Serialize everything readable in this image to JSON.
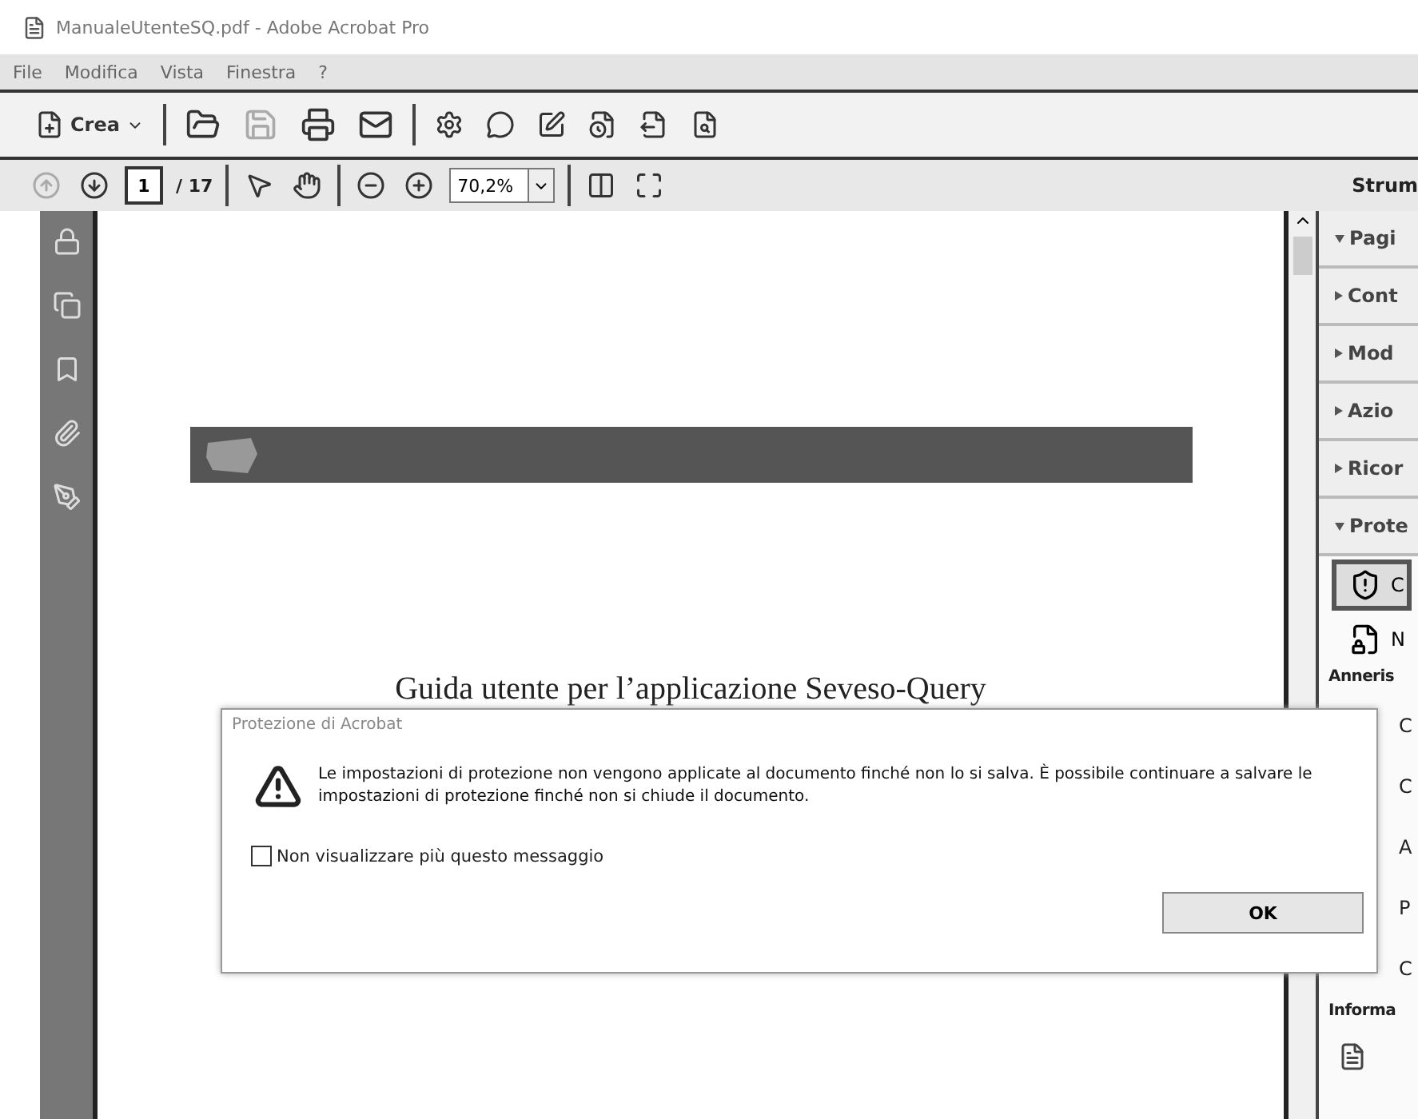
{
  "window": {
    "title": "ManualeUtenteSQ.pdf - Adobe Acrobat Pro"
  },
  "menu": [
    "File",
    "Modifica",
    "Vista",
    "Finestra",
    "?"
  ],
  "toolbar": {
    "create_label": "Crea"
  },
  "navigation": {
    "page": "1",
    "page_count": "/ 17",
    "zoom": "70,2%",
    "tools_label": "Strum"
  },
  "document": {
    "title": "Guida utente per l’applicazione Seveso-Query"
  },
  "right_panel": {
    "sections": [
      {
        "label": "Pagi",
        "expanded": true
      },
      {
        "label": "Cont",
        "expanded": false
      },
      {
        "label": "Mod",
        "expanded": false
      },
      {
        "label": "Azio",
        "expanded": false
      },
      {
        "label": "Ricor",
        "expanded": false
      },
      {
        "label": "Prote",
        "expanded": true
      }
    ],
    "protection_items": [
      {
        "label": "C",
        "selected": true
      },
      {
        "label": "N",
        "selected": false
      }
    ],
    "heading": "Anneris",
    "items": [
      "C",
      "C",
      "A",
      "P",
      "C"
    ],
    "footer_heading": "Informa"
  },
  "dialog": {
    "title": "Protezione di Acrobat",
    "message": "Le impostazioni di protezione non vengono applicate al documento finché non lo si salva. È possibile continuare a salvare le impostazioni di protezione finché non si chiude il documento.",
    "checkbox": {
      "label": "Non visualizzare più questo messaggio",
      "checked": false
    },
    "button": "OK"
  }
}
